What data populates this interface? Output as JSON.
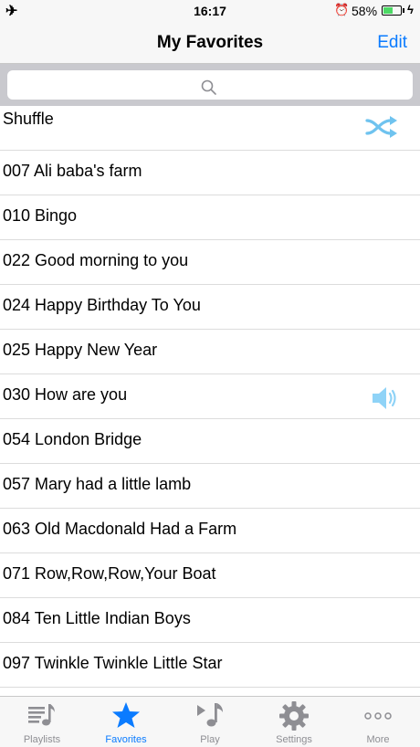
{
  "status_bar": {
    "time": "16:17",
    "battery": "58%",
    "battery_level": 0.58
  },
  "nav": {
    "title": "My Favorites",
    "edit_label": "Edit"
  },
  "search": {
    "placeholder": ""
  },
  "list": {
    "items": [
      {
        "label": "Shuffle"
      },
      {
        "label": "007 Ali baba's farm"
      },
      {
        "label": "010 Bingo"
      },
      {
        "label": "022 Good morning to you"
      },
      {
        "label": "024 Happy Birthday To You"
      },
      {
        "label": "025 Happy New Year"
      },
      {
        "label": "030 How are you"
      },
      {
        "label": "054 London Bridge"
      },
      {
        "label": "057 Mary had a little lamb"
      },
      {
        "label": "063 Old Macdonald Had a Farm"
      },
      {
        "label": "071 Row,Row,Row,Your Boat"
      },
      {
        "label": "084 Ten Little Indian Boys"
      },
      {
        "label": "097 Twinkle Twinkle Little Star"
      }
    ]
  },
  "tab_bar": {
    "tabs": [
      {
        "label": "Playlists",
        "icon": "playlist-icon"
      },
      {
        "label": "Favorites",
        "icon": "star-icon"
      },
      {
        "label": "Play",
        "icon": "music-note-icon"
      },
      {
        "label": "Settings",
        "icon": "gear-icon"
      },
      {
        "label": "More",
        "icon": "more-icon"
      }
    ],
    "active_tab": "Favorites"
  },
  "colors": {
    "accent": "#0a7bff",
    "inactive": "#8e8e93",
    "icon_light_blue": "#8fd3f7",
    "battery_green": "#4cd964"
  }
}
